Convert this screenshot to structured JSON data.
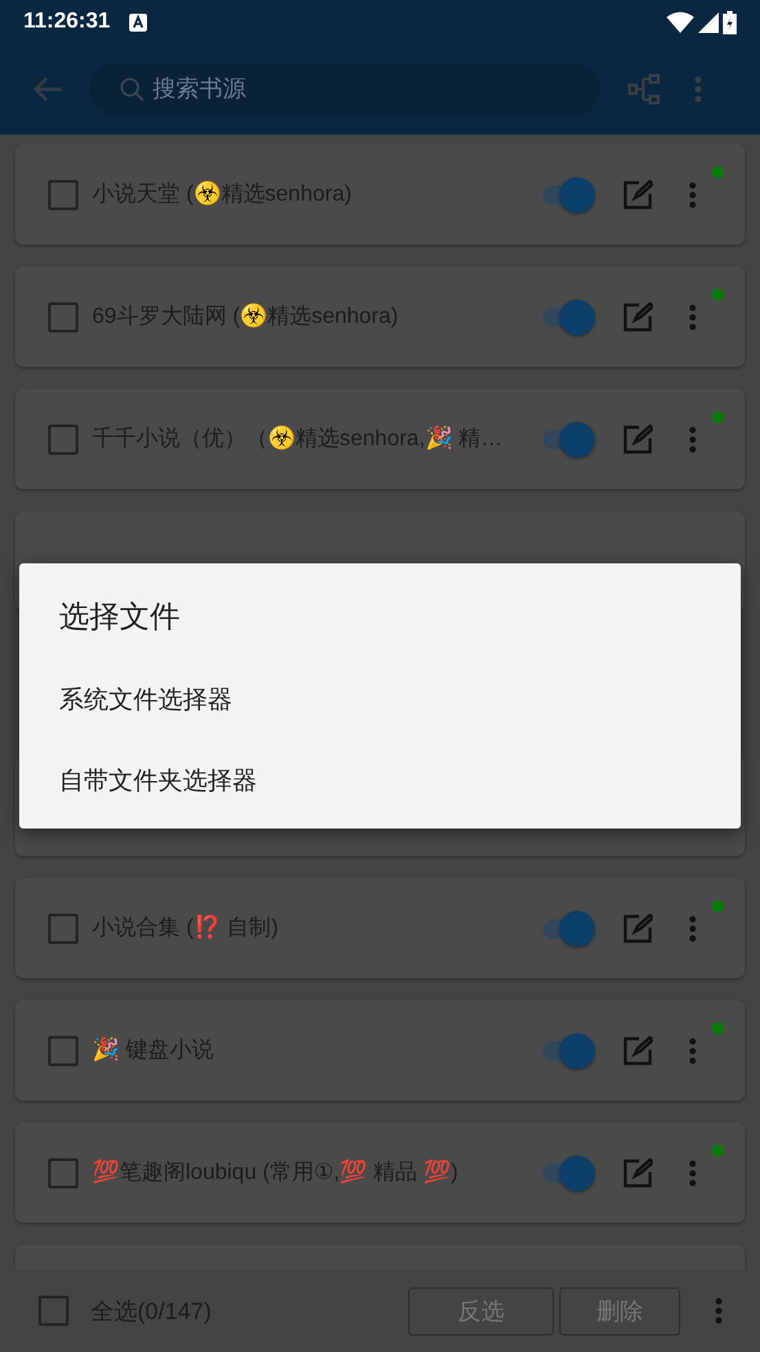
{
  "status_bar": {
    "time": "11:26:31"
  },
  "toolbar": {
    "search": {
      "placeholder": "搜索书源"
    }
  },
  "sources_above_dialog": [
    {
      "title": "小说天堂 (☣️精选senhora)",
      "checked": false,
      "enabled": true,
      "color": "#0a7a0a"
    },
    {
      "title": "69斗罗大陆网 (☣️精选senhora)",
      "checked": false,
      "enabled": true,
      "color": "#0a7a0a"
    },
    {
      "title": "千千小说（优）（☣️精选senhora,🎉 精…",
      "checked": false,
      "enabled": true,
      "color": "#0a7a0a"
    }
  ],
  "sources_below_dialog": [
    {
      "title": "小说合集 (⁉️ 自制)",
      "checked": false,
      "enabled": true,
      "color": "#0a7a0a"
    },
    {
      "title": "🎉 键盘小说",
      "checked": false,
      "enabled": true,
      "color": "#0a7a0a"
    },
    {
      "title": "💯笔趣阁loubiqu (常用①,💯 精品 💯)",
      "checked": false,
      "enabled": true,
      "color": "#0a7a0a"
    }
  ],
  "bottom_bar": {
    "select_all": {
      "label": "全选(0/147)",
      "checked": false
    },
    "buttons": [
      "反选",
      "删除"
    ]
  },
  "dialog": {
    "title": "选择文件",
    "options": [
      "系统文件选择器",
      "自带文件夹选择器"
    ]
  }
}
